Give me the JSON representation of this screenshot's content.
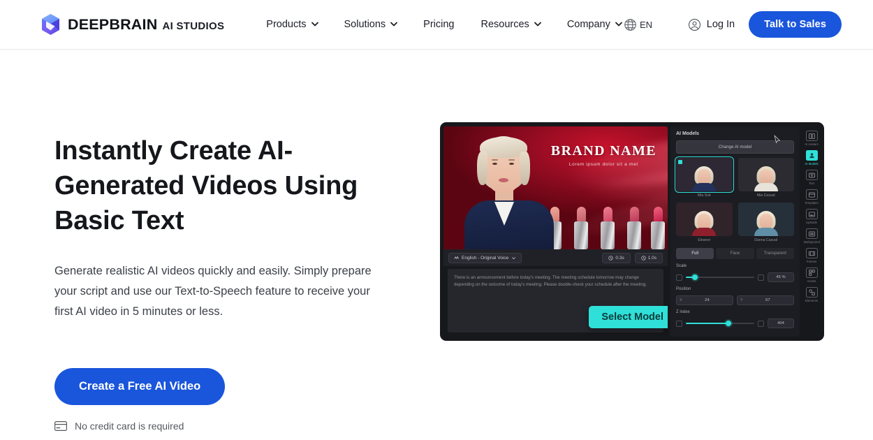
{
  "header": {
    "brand": {
      "name": "DEEPBRAIN",
      "sub": "AI STUDIOS",
      "logo_icon": "cube-logo-icon"
    },
    "nav": [
      {
        "label": "Products",
        "has_caret": true
      },
      {
        "label": "Solutions",
        "has_caret": true
      },
      {
        "label": "Pricing",
        "has_caret": false
      },
      {
        "label": "Resources",
        "has_caret": true
      },
      {
        "label": "Company",
        "has_caret": true
      }
    ],
    "language": {
      "label": "EN",
      "icon": "globe-icon"
    },
    "login": {
      "label": "Log In",
      "icon": "user-circle-icon"
    },
    "cta": {
      "label": "Talk to Sales"
    },
    "accent_blue": "#1a56db"
  },
  "hero": {
    "title": "Instantly Create AI-Generated Videos Using Basic Text",
    "subtitle": "Generate realistic AI videos quickly and easily. Simply prepare your script and use our Text-to-Speech feature to receive your first AI video in 5 minutes or less.",
    "cta_label": "Create a Free AI Video",
    "note": {
      "label": "No credit card is required",
      "icon": "credit-card-icon"
    }
  },
  "app_mock": {
    "preview": {
      "brand_headline": "BRAND NAME",
      "brand_tagline": "Lorem ipsum dolor sit a met"
    },
    "script_bar": {
      "voice_chip": "English - Original Voice",
      "durations": [
        "0.3s",
        "1.0s"
      ]
    },
    "script_text": "There is an announcement before today's meeting. The meeting schedule tomorrow may change depending on the outcome of today's meeting. Please double-check your schedule after the meeting.",
    "select_model_button": "Select Model",
    "panel": {
      "title": "AI Models",
      "change_button": "Change AI model",
      "models": [
        {
          "name": "Mia Suit",
          "selected": true,
          "hair": "#e9e0cf",
          "top": "#22305c"
        },
        {
          "name": "Mia Casual",
          "selected": false,
          "hair": "#e4d8c4",
          "top": "#e7e3da"
        },
        {
          "name": "Eleanor",
          "selected": false,
          "hair": "#efe6d6",
          "top": "#8f1f2c"
        },
        {
          "name": "Danna Casual",
          "selected": false,
          "hair": "#f0e6d3",
          "top": "#5e8fa6"
        }
      ],
      "segments": [
        {
          "label": "Full",
          "active": true
        },
        {
          "label": "Face",
          "active": false
        },
        {
          "label": "Transparent",
          "active": false
        }
      ],
      "controls": [
        {
          "label": "Scale",
          "value": "45 %",
          "fill_pct": 13
        },
        {
          "label": "Z index",
          "value": "404",
          "fill_pct": 62
        }
      ],
      "position": {
        "label": "Position",
        "x": "24",
        "y": "67"
      }
    },
    "rail": [
      {
        "label": "AI Avatars",
        "icon": "avatar-grid-icon",
        "active": false
      },
      {
        "label": "AI Models",
        "icon": "person-card-icon",
        "active": true
      },
      {
        "label": "Text",
        "icon": "text-box-icon",
        "active": false
      },
      {
        "label": "Templates",
        "icon": "template-icon",
        "active": false
      },
      {
        "label": "Uploads",
        "icon": "upload-image-icon",
        "active": false
      },
      {
        "label": "Background",
        "icon": "background-icon",
        "active": false
      },
      {
        "label": "Frames",
        "icon": "frames-icon",
        "active": false
      },
      {
        "label": "Assets",
        "icon": "assets-icon",
        "active": false
      },
      {
        "label": "Elements",
        "icon": "elements-icon",
        "active": false
      }
    ],
    "cursor_icon": "mouse-pointer-icon"
  }
}
